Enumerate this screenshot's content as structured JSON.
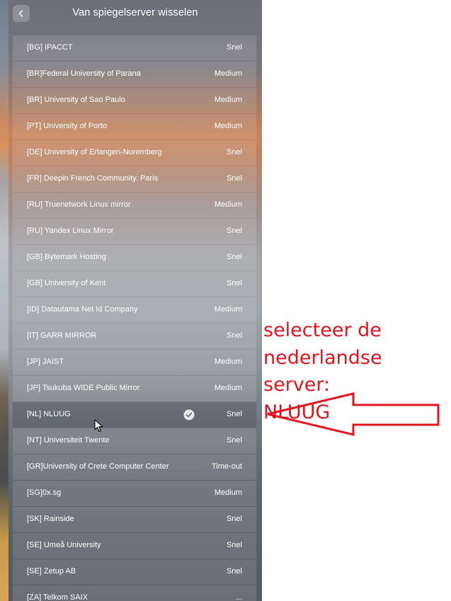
{
  "panel": {
    "title": "Van spiegelserver wisselen",
    "back_icon": "chevron-left-icon"
  },
  "mirrors": [
    {
      "name": "[BG] IPACCT",
      "speed": "Snel",
      "selected": false
    },
    {
      "name": "[BR]Federal University of Parana",
      "speed": "Medium",
      "selected": false
    },
    {
      "name": "[BR] University of Sao Paulo",
      "speed": "Medium",
      "selected": false
    },
    {
      "name": "[PT] University of Porto",
      "speed": "Medium",
      "selected": false
    },
    {
      "name": "[DE] University of Erlangen-Nuremberg",
      "speed": "Snel",
      "selected": false
    },
    {
      "name": "[FR] Deepin French Community. Paris",
      "speed": "Snel",
      "selected": false
    },
    {
      "name": "[RU] Truenetwork Linux mirror",
      "speed": "Medium",
      "selected": false
    },
    {
      "name": "[RU] Yandex Linux Mirror",
      "speed": "Snel",
      "selected": false
    },
    {
      "name": "[GB] Bytemark Hosting",
      "speed": "Snel",
      "selected": false
    },
    {
      "name": "[GB] University of Kent",
      "speed": "Snel",
      "selected": false
    },
    {
      "name": "[ID] Datautama Net Id Company",
      "speed": "Medium",
      "selected": false
    },
    {
      "name": "[IT] GARR MIRROR",
      "speed": "Snel",
      "selected": false
    },
    {
      "name": "[JP] JAIST",
      "speed": "Medium",
      "selected": false
    },
    {
      "name": "[JP] Tsukuba WIDE Public Mirror",
      "speed": "Medium",
      "selected": false
    },
    {
      "name": "[NL] NLUUG",
      "speed": "Snel",
      "selected": true
    },
    {
      "name": "[NT] Universiteit Twente",
      "speed": "Snel",
      "selected": false
    },
    {
      "name": "[GR]University of Crete Computer Center",
      "speed": "Time-out",
      "selected": false
    },
    {
      "name": "[SG]0x.sg",
      "speed": "Medium",
      "selected": false
    },
    {
      "name": "[SK] Rainside",
      "speed": "Snel",
      "selected": false
    },
    {
      "name": "[SE] Umeå University",
      "speed": "Snel",
      "selected": false
    },
    {
      "name": "[SE] Zetup AB",
      "speed": "Snel",
      "selected": false
    },
    {
      "name": "[ZA] Telkom SAIX",
      "speed": "...",
      "selected": false
    }
  ],
  "annotation": {
    "lines": [
      "selecteer de",
      "nederlandse server:",
      "NLUUG"
    ],
    "color": "#e0151f"
  },
  "icons": {
    "selected_check": "checkmark-circle-icon",
    "pointer": "mouse-cursor-icon",
    "annotation_arrow": "arrow-left-icon"
  }
}
